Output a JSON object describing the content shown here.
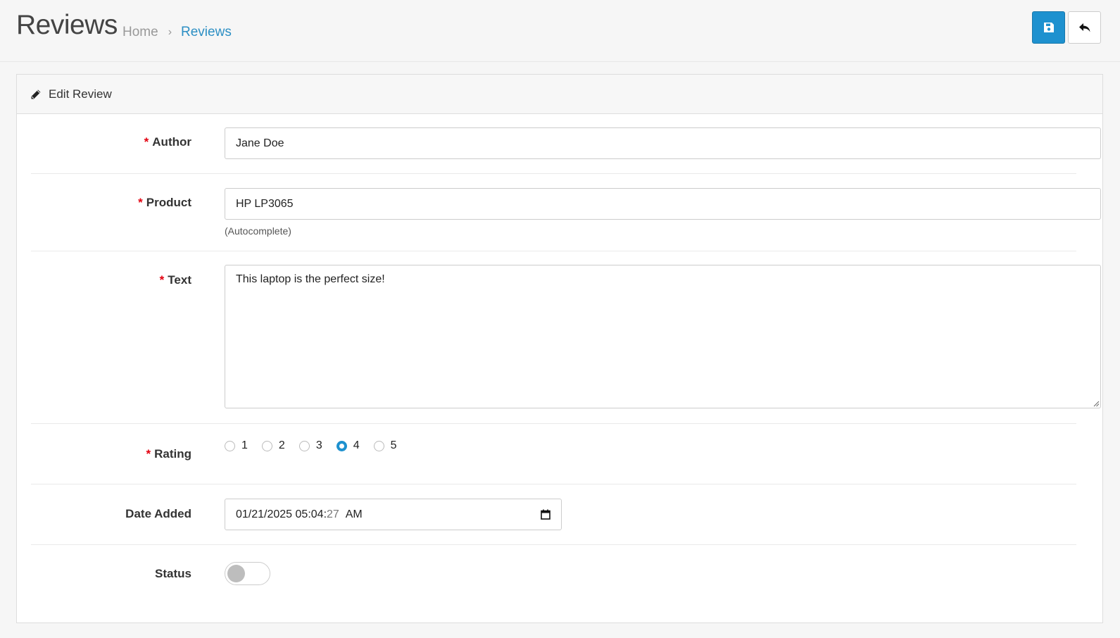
{
  "header": {
    "title": "Reviews",
    "breadcrumb": {
      "home": "Home",
      "separator": "›",
      "current": "Reviews"
    },
    "save_icon": "floppy-disk-icon",
    "back_icon": "reply-arrow-icon"
  },
  "card": {
    "title": "Edit Review",
    "title_icon": "pencil-icon"
  },
  "form": {
    "required_marker": "*",
    "author": {
      "label": "Author",
      "value": "Jane Doe"
    },
    "product": {
      "label": "Product",
      "value": "HP LP3065",
      "help": "(Autocomplete)"
    },
    "text": {
      "label": "Text",
      "value": "This laptop is the perfect size!"
    },
    "rating": {
      "label": "Rating",
      "options": [
        "1",
        "2",
        "3",
        "4",
        "5"
      ],
      "selected": "4"
    },
    "date_added": {
      "label": "Date Added",
      "value_main": "01/21/2025 05:04:",
      "value_seconds": "27",
      "value_period": "AM",
      "icon": "calendar-icon"
    },
    "status": {
      "label": "Status",
      "enabled": false
    }
  },
  "colors": {
    "primary": "#1e91cf",
    "required": "#e3000f",
    "breadcrumb_active": "#2c8fc4"
  }
}
